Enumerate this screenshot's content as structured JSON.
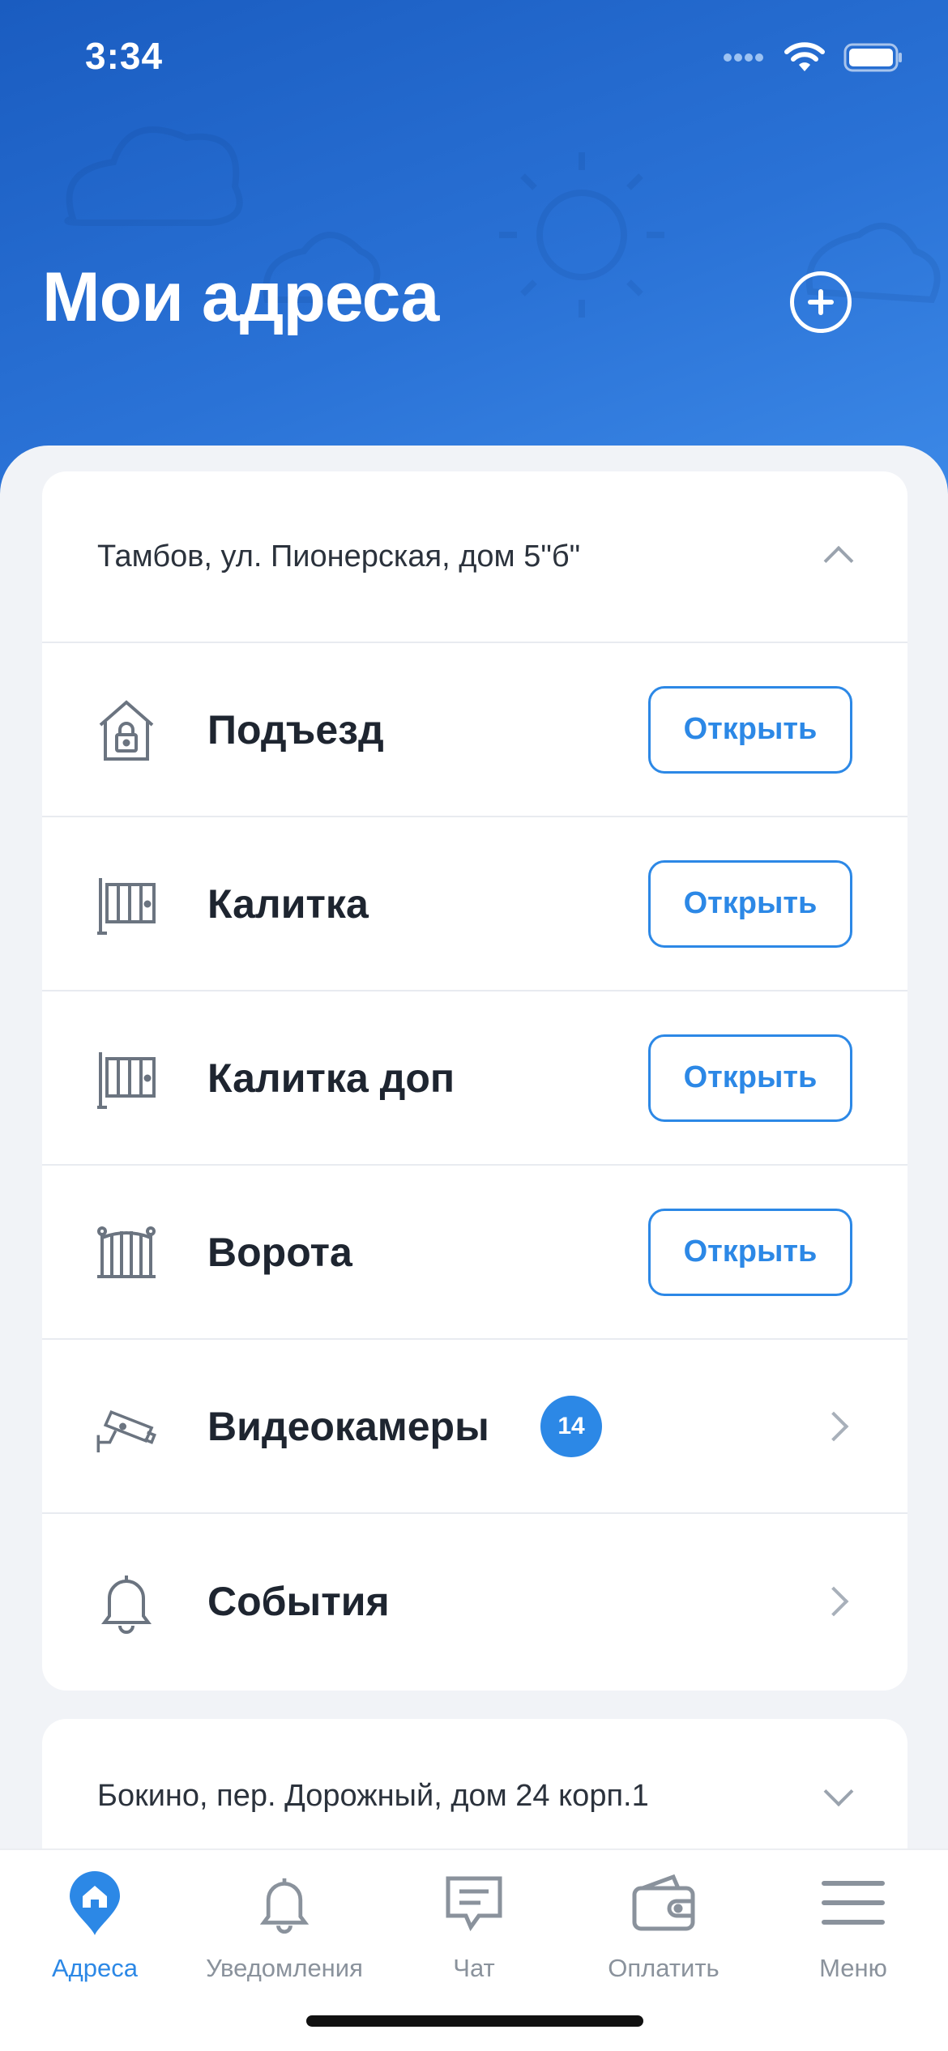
{
  "status_bar": {
    "time": "3:34"
  },
  "header": {
    "title": "Мои адреса"
  },
  "addresses": [
    {
      "address": "Тамбов, ул. Пионерская, дом 5\"б\"",
      "expanded": true,
      "items": [
        {
          "label": "Подъезд",
          "icon": "building-lock-icon",
          "action": "Открыть"
        },
        {
          "label": "Калитка",
          "icon": "gate-door-icon",
          "action": "Открыть"
        },
        {
          "label": "Калитка доп",
          "icon": "gate-door-icon",
          "action": "Открыть"
        },
        {
          "label": "Ворота",
          "icon": "gates-icon",
          "action": "Открыть"
        },
        {
          "label": "Видеокамеры",
          "icon": "camera-icon",
          "badge": "14"
        },
        {
          "label": "События",
          "icon": "bell-icon"
        }
      ]
    },
    {
      "address": "Бокино, пер. Дорожный, дом 24 корп.1",
      "expanded": false
    }
  ],
  "tab_bar": {
    "tabs": [
      {
        "label": "Адреса",
        "icon": "home-pin-icon",
        "active": true
      },
      {
        "label": "Уведомления",
        "icon": "bell-icon"
      },
      {
        "label": "Чат",
        "icon": "chat-icon"
      },
      {
        "label": "Оплатить",
        "icon": "wallet-icon"
      },
      {
        "label": "Меню",
        "icon": "menu-icon"
      }
    ]
  },
  "colors": {
    "accent": "#2c88e6",
    "header_top": "#1a5cc0",
    "header_bottom": "#3d8ae8"
  }
}
